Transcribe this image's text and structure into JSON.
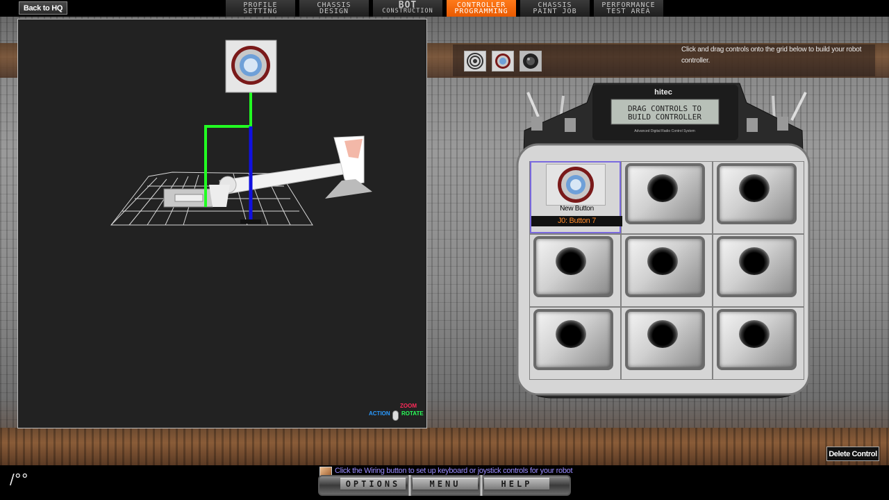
{
  "topbar": {
    "back_label": "Back to HQ",
    "tabs": [
      {
        "line1": "PROFILE",
        "line2": "SETTING",
        "active": false
      },
      {
        "line1": "CHASSIS",
        "line2": "DESIGN",
        "active": false
      },
      {
        "line1": "BOT",
        "line2": "CONSTRUCTION",
        "active": false
      },
      {
        "line1": "CONTROLLER",
        "line2": "PROGRAMMING",
        "active": true
      },
      {
        "line1": "CHASSIS",
        "line2": "PAINT JOB",
        "active": false
      },
      {
        "line1": "PERFORMANCE",
        "line2": "TEST AREA",
        "active": false
      }
    ]
  },
  "viewport": {
    "hint_zoom": "ZOOM",
    "hint_action": "ACTION",
    "hint_rotate": "ROTATE"
  },
  "palette": {
    "items": [
      "spiral-knob-icon",
      "red-push-button-icon",
      "dark-button-icon"
    ]
  },
  "instruction": "Click and drag controls onto the grid below to build your robot controller.",
  "controller": {
    "brand": "hitec",
    "screen_line1": "DRAG CONTROLS TO",
    "screen_line2": "BUILD  CONTROLLER",
    "subtitle": "Advanced Digital Radio Control System",
    "placed_control": {
      "name": "New Button",
      "binding": "J0: Button 7"
    }
  },
  "delete_label": "Delete Control",
  "bottom": {
    "logo": "/°°",
    "tip": "Click the Wiring button to set up keyboard or joystick controls for your robot",
    "menu": [
      "OPTIONS",
      "MENU",
      "HELP"
    ]
  },
  "colors": {
    "active_tab": "#ff7a1a",
    "binding_text": "#ff8a2a",
    "selection_border": "#7a6adf",
    "wire_green": "#22ff22",
    "wire_blue": "#1010e0",
    "tip_text": "#9a8cff"
  }
}
